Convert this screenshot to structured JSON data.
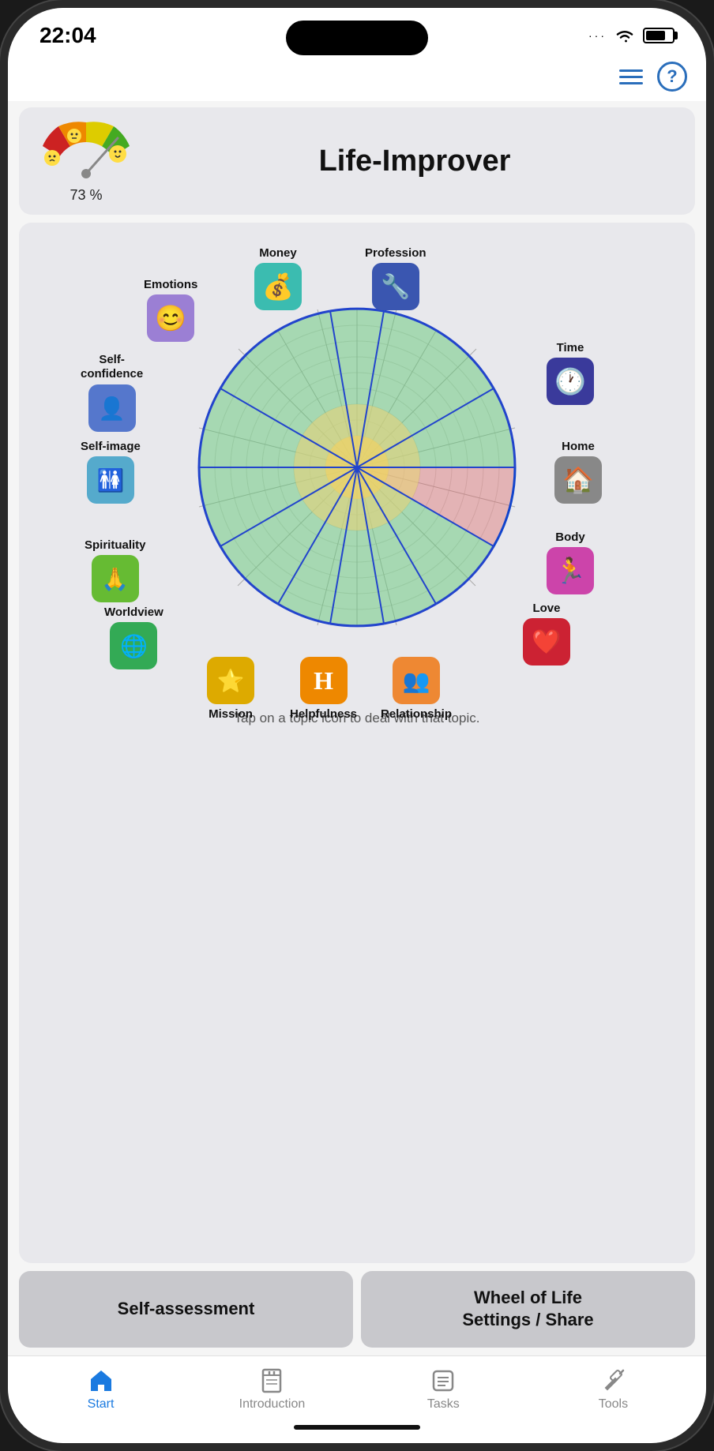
{
  "status": {
    "time": "22:04",
    "dots": "···",
    "wifi": "📶",
    "battery": 75
  },
  "header": {
    "title": "Life-Improver",
    "gauge_value": "73 %",
    "menu_icon": "hamburger",
    "help_icon": "question"
  },
  "wheel": {
    "topics": [
      {
        "id": "money",
        "label": "Money",
        "color": "#3bbcb0",
        "icon": "💰",
        "position": "top-center-left"
      },
      {
        "id": "profession",
        "label": "Profession",
        "color": "#3a56b0",
        "icon": "🔧",
        "position": "top-center-right"
      },
      {
        "id": "emotions",
        "label": "Emotions",
        "color": "#9b7fd4",
        "icon": "😊",
        "position": "top-left"
      },
      {
        "id": "time",
        "label": "Time",
        "color": "#3a3a9b",
        "icon": "🕐",
        "position": "right-top"
      },
      {
        "id": "self-confidence",
        "label": "Self-\nconfidence",
        "color": "#5577cc",
        "icon": "🧑",
        "position": "left-top"
      },
      {
        "id": "home",
        "label": "Home",
        "color": "#888",
        "icon": "🏠",
        "position": "right-mid"
      },
      {
        "id": "self-image",
        "label": "Self-image",
        "color": "#55aacc",
        "icon": "🚻",
        "position": "left-mid"
      },
      {
        "id": "body",
        "label": "Body",
        "color": "#cc44aa",
        "icon": "🏃",
        "position": "right-bottom"
      },
      {
        "id": "spirituality",
        "label": "Spirituality",
        "color": "#66bb33",
        "icon": "🙏",
        "position": "left-bottom"
      },
      {
        "id": "love",
        "label": "Love",
        "color": "#cc2233",
        "icon": "❤️",
        "position": "right-low"
      },
      {
        "id": "worldview",
        "label": "Worldview",
        "color": "#33aa55",
        "icon": "🌐",
        "position": "left-low"
      },
      {
        "id": "relationship",
        "label": "Relationship",
        "color": "#ee8833",
        "icon": "👥",
        "position": "bottom-right"
      },
      {
        "id": "mission",
        "label": "Mission",
        "color": "#ddaa00",
        "icon": "⭐",
        "position": "bottom-left"
      },
      {
        "id": "helpfulness",
        "label": "Helpfulness",
        "color": "#ee8800",
        "icon": "H",
        "position": "bottom-center"
      }
    ],
    "hint": "Tap on a topic icon to deal with that topic."
  },
  "buttons": {
    "self_assessment": "Self-assessment",
    "wheel_settings": "Wheel of Life\nSettings / Share"
  },
  "tabs": [
    {
      "id": "start",
      "label": "Start",
      "icon": "🏠",
      "active": true
    },
    {
      "id": "introduction",
      "label": "Introduction",
      "icon": "📖",
      "active": false
    },
    {
      "id": "tasks",
      "label": "Tasks",
      "icon": "📋",
      "active": false
    },
    {
      "id": "tools",
      "label": "Tools",
      "icon": "🔨",
      "active": false
    }
  ]
}
